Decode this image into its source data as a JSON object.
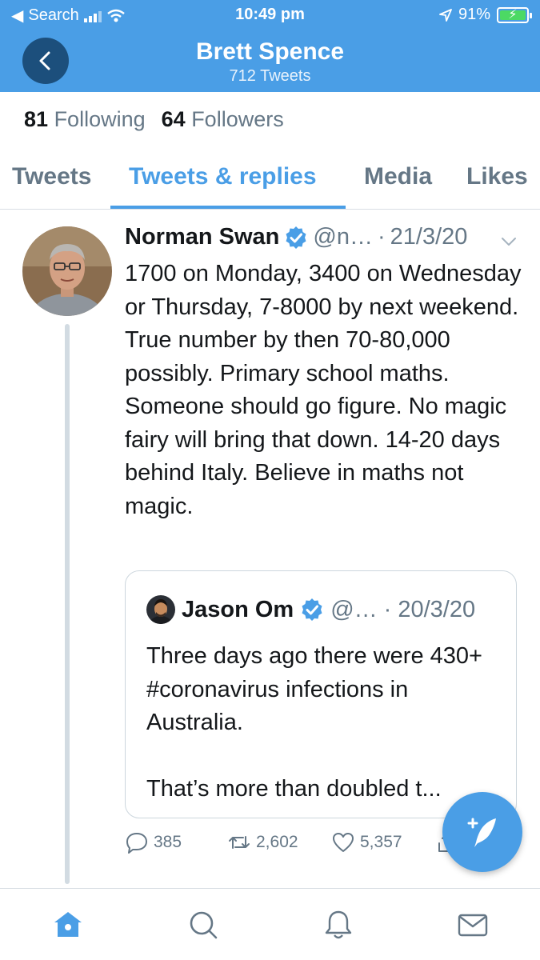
{
  "status_bar": {
    "back_app": "Search",
    "time": "10:49 pm",
    "battery": "91%"
  },
  "profile": {
    "name": "Brett Spence",
    "tweet_count": "712 Tweets",
    "following_count": "81",
    "following_label": "Following",
    "followers_count": "64",
    "followers_label": "Followers"
  },
  "tabs": [
    {
      "label": "Tweets"
    },
    {
      "label": "Tweets & replies"
    },
    {
      "label": "Media"
    },
    {
      "label": "Likes"
    }
  ],
  "active_tab": "Tweets & replies",
  "tweet": {
    "author": "Norman Swan",
    "handle": "@n…",
    "separator": "·",
    "date": "21/3/20",
    "text": "1700 on Monday, 3400 on Wednesday or Thursday, 7-8000 by next weekend. True number by then 70-80,000 possibly. Primary school maths. Someone should go figure. No magic fairy will bring that down. 14-20 days behind Italy. Believe in maths not magic.",
    "quote": {
      "author": "Jason Om",
      "handle": "@…",
      "separator": "·",
      "date": "20/3/20",
      "text_1": "Three days ago there were 430+ #coronavirus infections in Australia.",
      "text_2": "That’s more than doubled t..."
    },
    "actions": {
      "replies": "385",
      "retweets": "2,602",
      "likes": "5,357"
    }
  },
  "icons": {
    "back": "back-arrow-icon",
    "verified": "verified-badge-icon",
    "more": "chevron-down-icon",
    "reply": "reply-icon",
    "retweet": "retweet-icon",
    "like": "heart-icon",
    "share": "share-icon",
    "compose": "compose-tweet-icon",
    "home": "home-icon",
    "search": "search-icon",
    "notifications": "bell-icon",
    "messages": "mail-icon"
  },
  "colors": {
    "accent": "#4a9ee6",
    "header": "#4a9ee6",
    "back_button": "#1c4f7c",
    "muted_text": "#657786",
    "battery_fill": "#4cd964"
  }
}
